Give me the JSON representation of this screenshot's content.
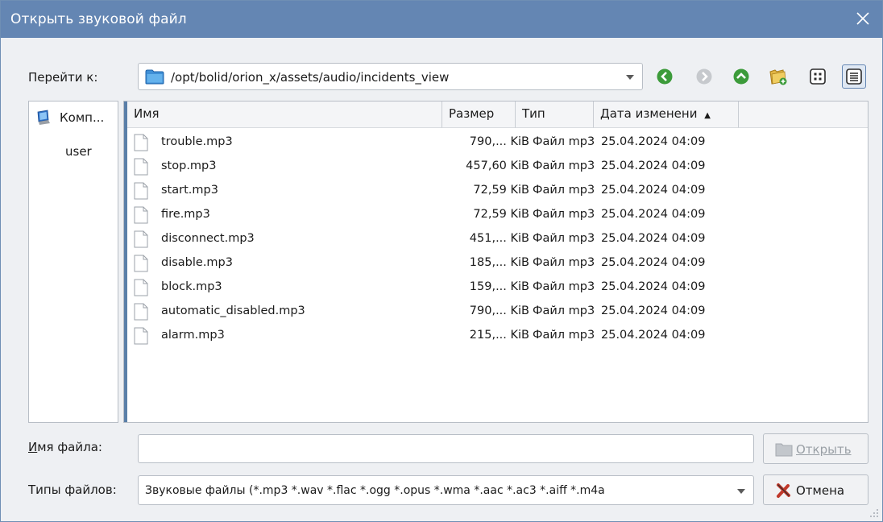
{
  "window": {
    "title": "Открыть звуковой файл"
  },
  "location": {
    "label": "Перейти к:",
    "path": "/opt/bolid/orion_x/assets/audio/incidents_view"
  },
  "toolbar": {
    "icons": [
      "back-icon",
      "forward-icon",
      "up-icon",
      "new-folder-icon",
      "list-view-icon",
      "detail-view-icon"
    ]
  },
  "places": [
    {
      "label": "Комп...",
      "icon": "computer-icon"
    },
    {
      "label": "user"
    }
  ],
  "columns": {
    "name": "Имя",
    "size": "Размер",
    "type": "Тип",
    "date": "Дата изменени",
    "sort_indicator": "▲"
  },
  "files": [
    {
      "name": "trouble.mp3",
      "size": "790,... KiB",
      "type": "Файл mp3",
      "date": "25.04.2024 04:09"
    },
    {
      "name": "stop.mp3",
      "size": "457,60 KiB",
      "type": "Файл mp3",
      "date": "25.04.2024 04:09"
    },
    {
      "name": "start.mp3",
      "size": "72,59 KiB",
      "type": "Файл mp3",
      "date": "25.04.2024 04:09"
    },
    {
      "name": "fire.mp3",
      "size": "72,59 KiB",
      "type": "Файл mp3",
      "date": "25.04.2024 04:09"
    },
    {
      "name": "disconnect.mp3",
      "size": "451,... KiB",
      "type": "Файл mp3",
      "date": "25.04.2024 04:09"
    },
    {
      "name": "disable.mp3",
      "size": "185,... KiB",
      "type": "Файл mp3",
      "date": "25.04.2024 04:09"
    },
    {
      "name": "block.mp3",
      "size": "159,... KiB",
      "type": "Файл mp3",
      "date": "25.04.2024 04:09"
    },
    {
      "name": "automatic_disabled.mp3",
      "size": "790,... KiB",
      "type": "Файл mp3",
      "date": "25.04.2024 04:09"
    },
    {
      "name": "alarm.mp3",
      "size": "215,... KiB",
      "type": "Файл mp3",
      "date": "25.04.2024 04:09"
    }
  ],
  "filename": {
    "label": "Имя файла:",
    "value": "",
    "open_button": "Открыть"
  },
  "filetypes": {
    "label": "Типы файлов:",
    "selected": "Звуковые файлы (*.mp3 *.wav *.flac *.ogg *.opus *.wma *.aac *.ac3 *.aiff *.m4a",
    "cancel_button": "Отмена"
  },
  "colors": {
    "titlebar": "#6486b3",
    "dialog_bg": "#eef0f3",
    "accent": "#5a7fa8"
  }
}
